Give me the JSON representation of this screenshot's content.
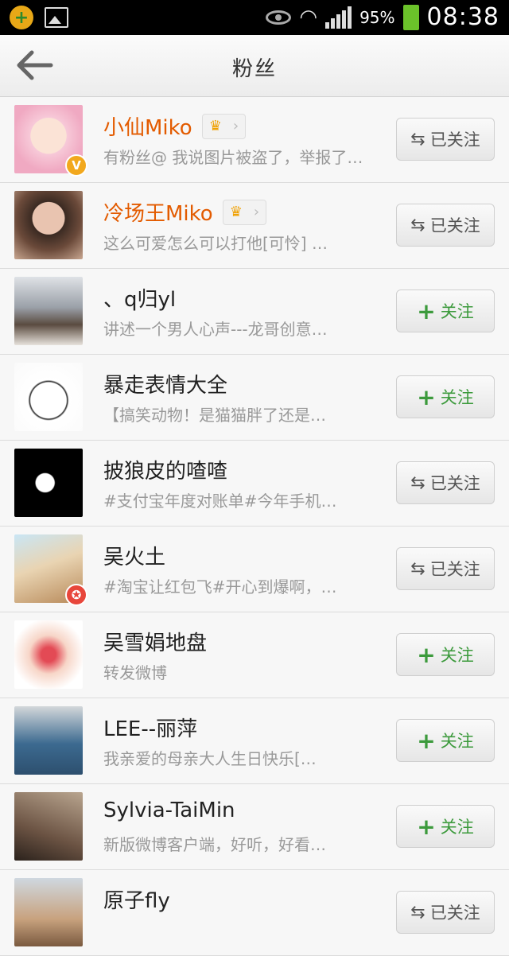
{
  "status_bar": {
    "battery": "95%",
    "time": "08:38"
  },
  "header": {
    "title": "粉丝"
  },
  "fans": [
    {
      "name": "小仙Miko",
      "vip": true,
      "desc": "有粉丝@ 我说图片被盗了，举报了…",
      "button": "已关注",
      "followed": true,
      "badge": "V",
      "badge_color": "#f2a81d"
    },
    {
      "name": "冷场王Miko",
      "vip": true,
      "desc": "这么可爱怎么可以打他[可怜] …",
      "button": "已关注",
      "followed": true
    },
    {
      "name": "、q归yl",
      "vip": false,
      "desc": "讲述一个男人心声---龙哥创意…",
      "button": "关注",
      "followed": false
    },
    {
      "name": "暴走表情大全",
      "vip": false,
      "desc": "【搞笑动物！是猫猫胖了还是…",
      "button": "关注",
      "followed": false
    },
    {
      "name": "披狼皮的喳喳",
      "vip": false,
      "desc": "#支付宝年度对账单#今年手机…",
      "button": "已关注",
      "followed": true
    },
    {
      "name": "吴火土",
      "vip": false,
      "desc": "#淘宝让红包飞#开心到爆啊，…",
      "button": "已关注",
      "followed": true,
      "badge": "✪",
      "badge_color": "#e8463b"
    },
    {
      "name": "吴雪娟地盘",
      "vip": false,
      "desc": "转发微博",
      "button": "关注",
      "followed": false
    },
    {
      "name": "LEE--丽萍",
      "vip": false,
      "desc": "我亲爱的母亲大人生日快乐[…",
      "button": "关注",
      "followed": false
    },
    {
      "name": "Sylvia-TaiMin",
      "vip": false,
      "desc": "新版微博客户端，好听，好看…",
      "button": "关注",
      "followed": false
    },
    {
      "name": "原子fly",
      "vip": false,
      "desc": "",
      "button": "已关注",
      "followed": true
    }
  ],
  "colors": {
    "vip_name": "#e35b00",
    "follow_green": "#3c9a3c"
  }
}
